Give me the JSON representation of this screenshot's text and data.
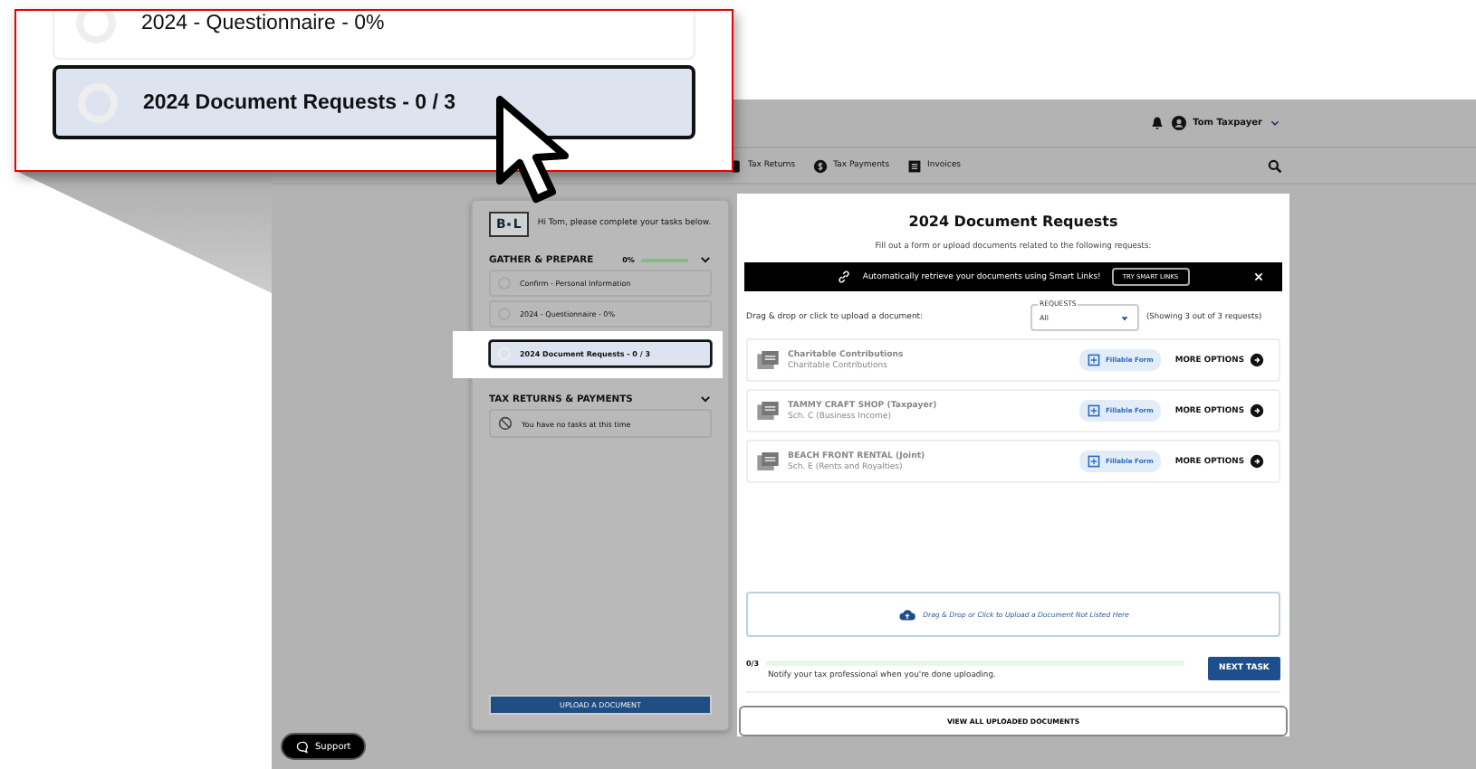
{
  "header": {
    "user_name": "Tom Taxpayer"
  },
  "nav": [
    {
      "label": "Tax Returns",
      "kind": "returns"
    },
    {
      "label": "Tax Payments",
      "kind": "payments"
    },
    {
      "label": "Invoices",
      "kind": "invoices"
    }
  ],
  "sidebar": {
    "logo_left": "B",
    "logo_right": "L",
    "greeting": "Hi Tom, please complete your tasks below.",
    "sections": [
      {
        "title": "GATHER & PREPARE",
        "progress": "0%",
        "level": 0,
        "expanded": true,
        "tasks": [
          {
            "label": "Confirm - Personal Information",
            "selected": false
          },
          {
            "label": "2024 - Questionnaire - 0%",
            "selected": false
          },
          {
            "label": "2024 Document Requests - 0 / 3",
            "selected": true
          }
        ]
      },
      {
        "title": "TAX RETURNS & PAYMENTS",
        "expanded": true,
        "empty_message": "You have no tasks at this time"
      }
    ],
    "upload_button": "UPLOAD A DOCUMENT"
  },
  "main": {
    "title": "2024 Document Requests",
    "subtitle": "Fill out a form or upload documents related to the following requests:",
    "banner": {
      "text": "Automatically retrieve your documents using Smart Links!",
      "button": "TRY SMART LINKS"
    },
    "drop_label": "Drag & drop or click to upload a document:",
    "filter": {
      "label": "REQUESTS",
      "value": "All"
    },
    "showing": "(Showing 3 out of 3 requests)",
    "requests": [
      {
        "title": "Charitable Contributions",
        "subtitle": "Charitable Contributions",
        "form_label": "Fillable Form",
        "more": "MORE OPTIONS"
      },
      {
        "title": "TAMMY CRAFT SHOP (Taxpayer)",
        "subtitle": "Sch. C (Business Income)",
        "form_label": "Fillable Form",
        "more": "MORE OPTIONS"
      },
      {
        "title": "BEACH FRONT RENTAL (Joint)",
        "subtitle": "Sch. E (Rents and Royalties)",
        "form_label": "Fillable Form",
        "more": "MORE OPTIONS"
      }
    ],
    "dropzone": "Drag & Drop or Click to Upload a Document Not Listed Here",
    "progress": {
      "count": "0/3",
      "level": 0,
      "note": "Notify your tax professional when you're done uploading."
    },
    "next_button": "NEXT TASK",
    "view_all_button": "VIEW ALL UPLOADED DOCUMENTS"
  },
  "support": "Support",
  "callout": {
    "tasks": [
      {
        "label": "2024 - Questionnaire - 0%",
        "selected": false
      },
      {
        "label": "2024 Document Requests - 0 / 3",
        "selected": true
      }
    ]
  }
}
